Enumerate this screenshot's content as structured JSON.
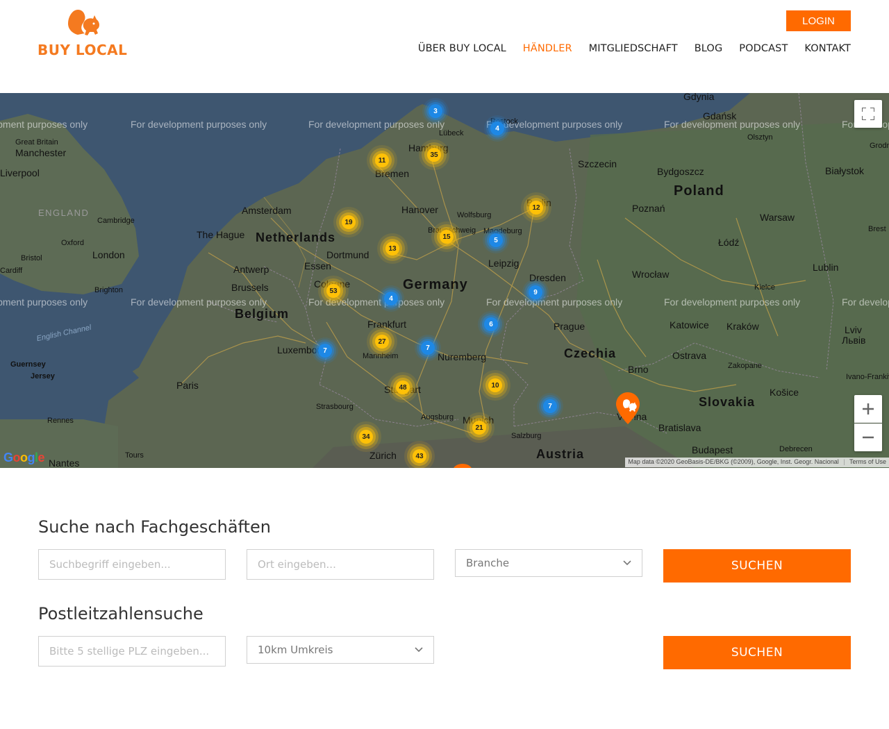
{
  "header": {
    "logo_text": "BUY LOCAL",
    "login_label": "LOGIN",
    "nav": [
      {
        "label": "ÜBER BUY LOCAL",
        "active": false
      },
      {
        "label": "HÄNDLER",
        "active": true
      },
      {
        "label": "MITGLIEDSCHAFT",
        "active": false
      },
      {
        "label": "BLOG",
        "active": false
      },
      {
        "label": "PODCAST",
        "active": false
      },
      {
        "label": "KONTAKT",
        "active": false
      }
    ]
  },
  "map": {
    "watermark": "For development purposes only",
    "google_logo": "Google",
    "attribution": "Map data ©2020 GeoBasis-DE/BKG (©2009), Google, Inst. Geogr. Nacional",
    "terms": "Terms of Use",
    "countries": [
      "Poland",
      "Netherlands",
      "Germany",
      "Belgium",
      "Czechia",
      "Slovakia",
      "Austria"
    ],
    "cities": [
      "Gdynia",
      "Gdańsk",
      "Olsztyn",
      "Szczecin",
      "Bydgoszcz",
      "Białystok",
      "Poznań",
      "Warsaw",
      "Łódź",
      "Lublin",
      "Wrocław",
      "Kielce",
      "Katowice",
      "Kraków",
      "Lviv",
      "Львів",
      "Ostrava",
      "Zakopane",
      "Košice",
      "Ivano-Frankivsk",
      "Bratislava",
      "Budapest",
      "Debrecen",
      "Brno",
      "Vienna",
      "Prague",
      "Dresden",
      "Leipzig",
      "Magdeburg",
      "Berlin",
      "Wolfsburg",
      "Hanover",
      "Braunschweig",
      "Hamburg",
      "Lübeck",
      "Rostock",
      "Bremen",
      "Amsterdam",
      "The Hague",
      "Dortmund",
      "Essen",
      "Cologne",
      "Antwerp",
      "Brussels",
      "Frankfurt",
      "Mannheim",
      "Nuremberg",
      "Stuttgart",
      "Strasbourg",
      "Luxembourg",
      "Augsburg",
      "Munich",
      "Salzburg",
      "Zürich",
      "Paris",
      "Rennes",
      "Tours",
      "Nantes",
      "Guernsey",
      "Jersey",
      "Brighton",
      "London",
      "Oxford",
      "Bristol",
      "Cardiff",
      "Cambridge",
      "Liverpool",
      "Manchester",
      "Great Britain",
      "Grodno",
      "Brest"
    ],
    "regions": [
      "ENGLAND"
    ],
    "water": [
      "English Channel"
    ],
    "clusters": [
      {
        "count": "3",
        "color": "blue"
      },
      {
        "count": "4",
        "color": "blue"
      },
      {
        "count": "35",
        "color": "yellow"
      },
      {
        "count": "11",
        "color": "yellow"
      },
      {
        "count": "12",
        "color": "yellow"
      },
      {
        "count": "19",
        "color": "yellow"
      },
      {
        "count": "15",
        "color": "yellow"
      },
      {
        "count": "5",
        "color": "blue"
      },
      {
        "count": "13",
        "color": "yellow"
      },
      {
        "count": "53",
        "color": "yellow"
      },
      {
        "count": "4",
        "color": "blue"
      },
      {
        "count": "9",
        "color": "blue"
      },
      {
        "count": "6",
        "color": "blue"
      },
      {
        "count": "27",
        "color": "yellow"
      },
      {
        "count": "7",
        "color": "blue"
      },
      {
        "count": "7",
        "color": "blue"
      },
      {
        "count": "48",
        "color": "yellow"
      },
      {
        "count": "10",
        "color": "yellow"
      },
      {
        "count": "7",
        "color": "blue"
      },
      {
        "count": "21",
        "color": "yellow"
      },
      {
        "count": "34",
        "color": "yellow"
      },
      {
        "count": "43",
        "color": "yellow"
      }
    ]
  },
  "search": {
    "title": "Suche nach Fachgeschäften",
    "keyword_placeholder": "Suchbegriff eingeben...",
    "location_placeholder": "Ort eingeben...",
    "category_value": "Branche",
    "submit_label": "SUCHEN"
  },
  "plz": {
    "title": "Postleitzahlensuche",
    "plz_placeholder": "Bitte 5 stellige PLZ eingeben...",
    "radius_value": "10km Umkreis",
    "submit_label": "SUCHEN"
  },
  "colors": {
    "accent": "#ff6a00",
    "cluster_yellow": "#ffc107",
    "cluster_blue": "#1e88e5"
  }
}
